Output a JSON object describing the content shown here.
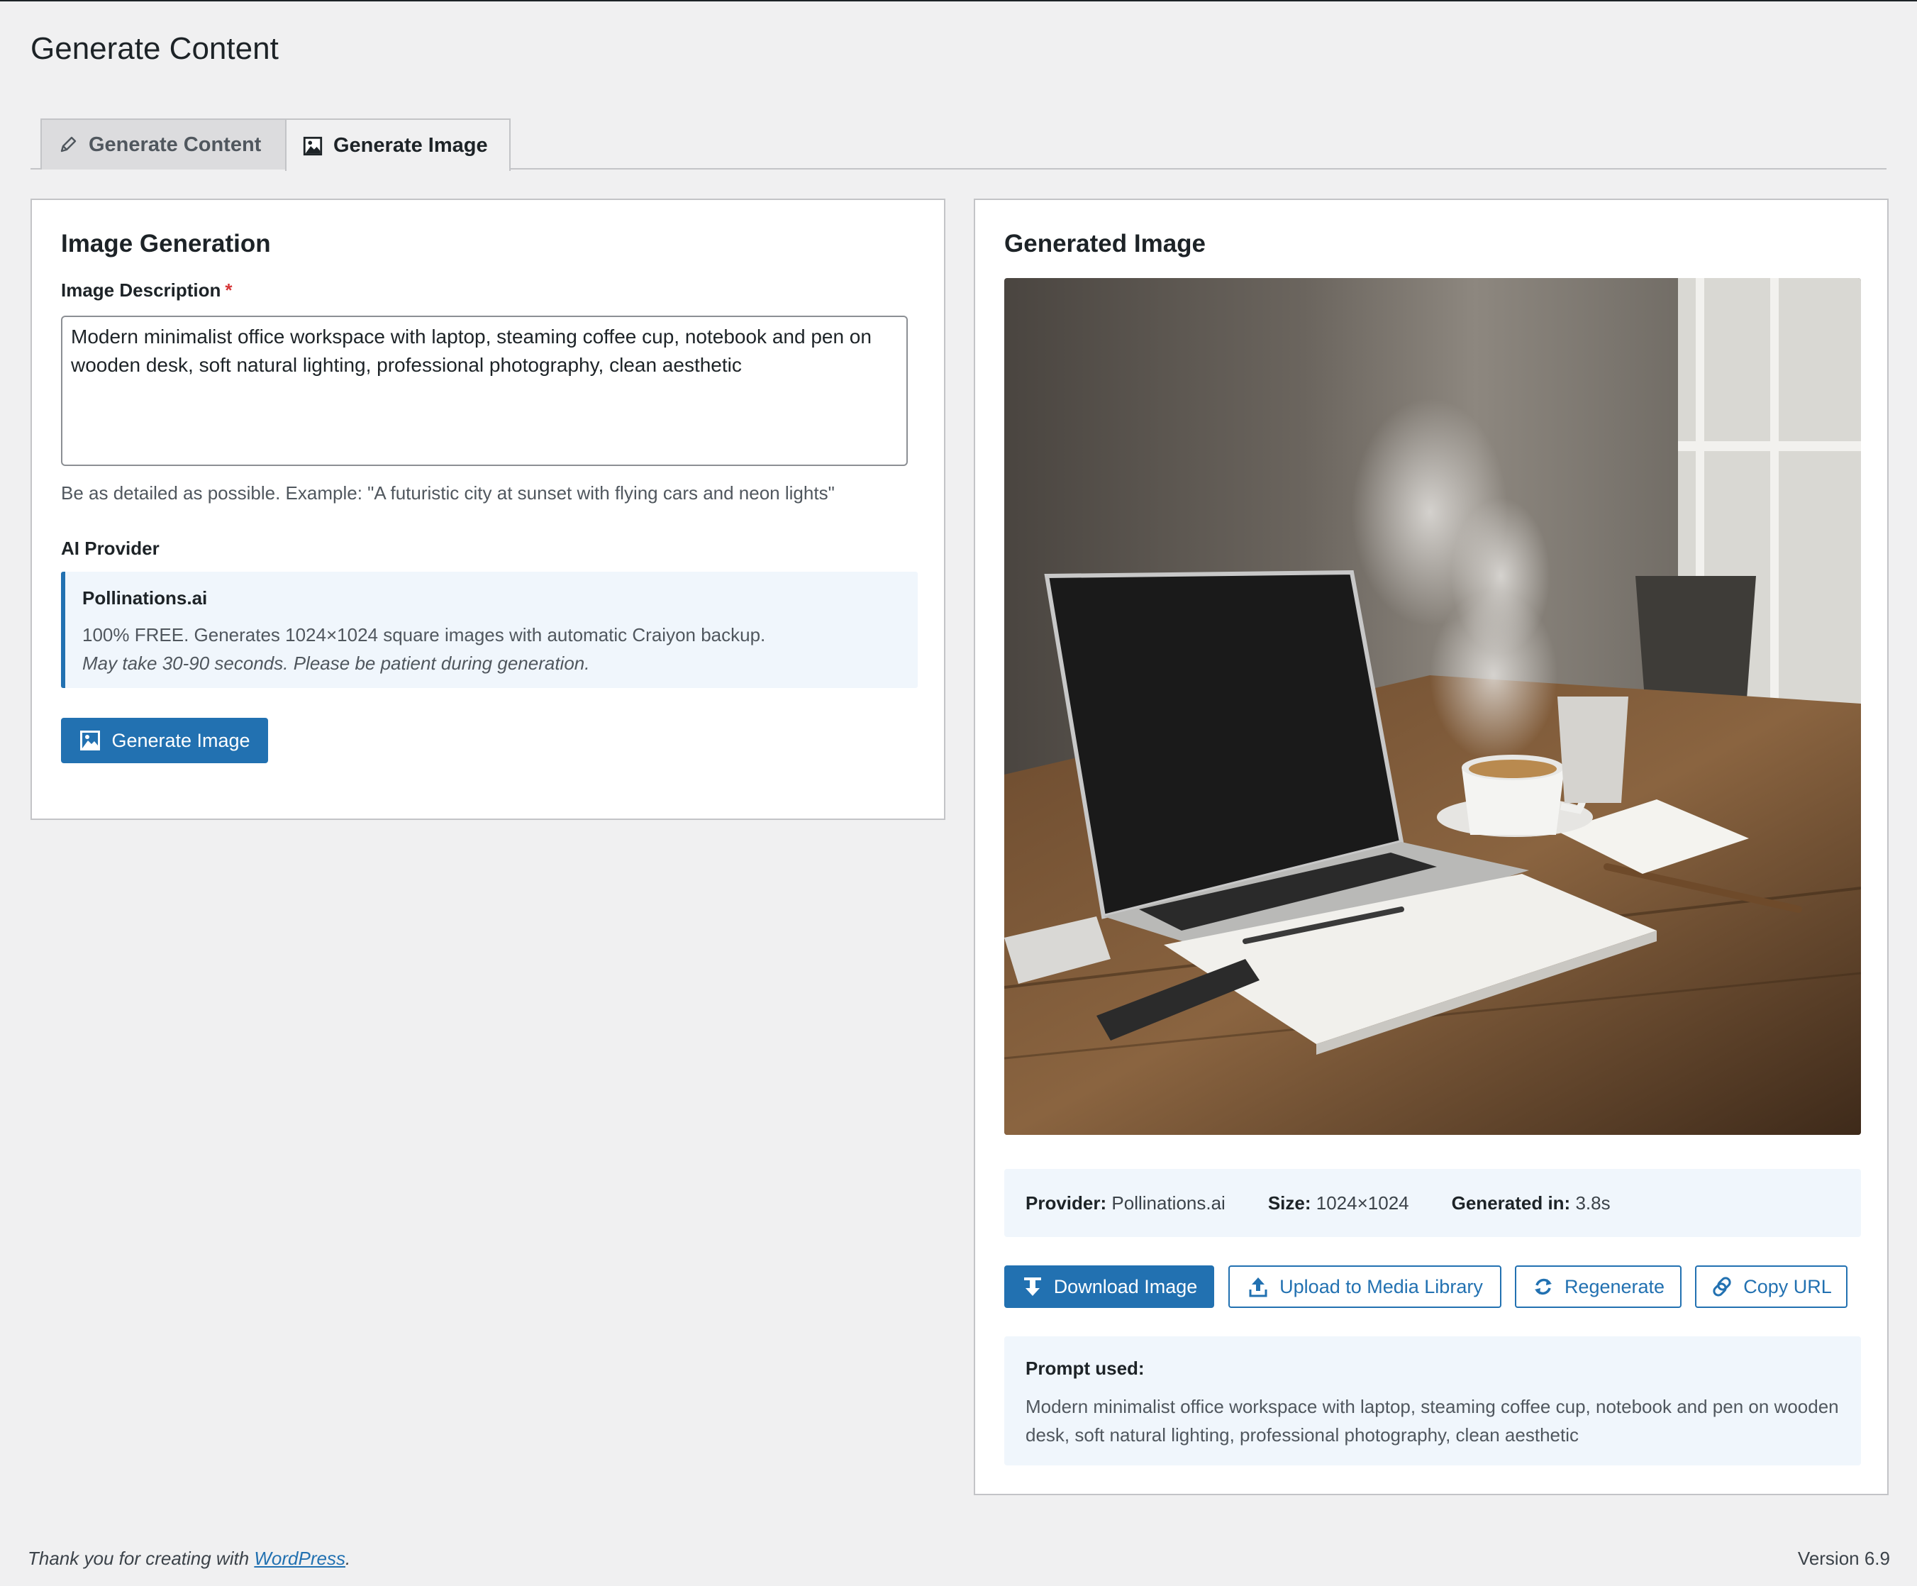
{
  "page": {
    "title": "Generate Content"
  },
  "tabs": [
    {
      "label": "Generate Content",
      "icon": "pencil-icon",
      "active": false
    },
    {
      "label": "Generate Image",
      "icon": "image-icon",
      "active": true
    }
  ],
  "left_panel": {
    "title": "Image Generation",
    "description_label": "Image Description",
    "required_mark": "*",
    "description_value": "Modern minimalist office workspace with laptop, steaming coffee cup, notebook and pen on wooden desk, soft natural lighting, professional photography, clean aesthetic",
    "help_text": "Be as detailed as possible. Example: \"A futuristic city at sunset with flying cars and neon lights\"",
    "provider_label": "AI Provider",
    "provider": {
      "name": "Pollinations.ai",
      "line1": "100% FREE. Generates 1024×1024 square images with automatic Craiyon backup.",
      "line2": "May take 30-90 seconds. Please be patient during generation."
    },
    "generate_button": "Generate Image"
  },
  "right_panel": {
    "title": "Generated Image",
    "meta": {
      "provider_label": "Provider:",
      "provider_value": "Pollinations.ai",
      "size_label": "Size:",
      "size_value": "1024×1024",
      "time_label": "Generated in:",
      "time_value": "3.8s"
    },
    "buttons": {
      "download": "Download Image",
      "upload": "Upload to Media Library",
      "regenerate": "Regenerate",
      "copy_url": "Copy URL"
    },
    "prompt_label": "Prompt used:",
    "prompt_text": "Modern minimalist office workspace with laptop, steaming coffee cup, notebook and pen on wooden desk, soft natural lighting, professional photography, clean aesthetic"
  },
  "footer": {
    "thanks_prefix": "Thank you for creating with ",
    "link_text": "WordPress",
    "thanks_suffix": ".",
    "version": "Version 6.9"
  },
  "colors": {
    "accent": "#2271b1",
    "info_bg": "#f0f6fc",
    "required": "#d63638"
  }
}
